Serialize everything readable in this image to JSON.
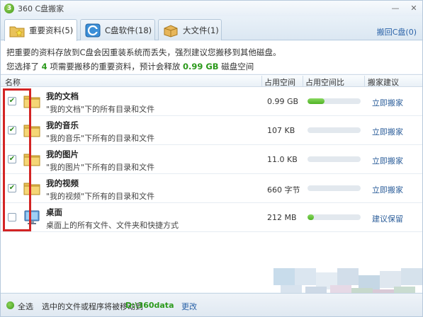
{
  "window": {
    "title": "360 C盘搬家",
    "logo_text": "3"
  },
  "tabs": [
    {
      "label": "重要资料(5)"
    },
    {
      "label": "C盘软件(18)"
    },
    {
      "label": "大文件(1)"
    }
  ],
  "header_link": "搬回C盘(0)",
  "info": {
    "line1": "把重要的资料存放到C盘会因重装系统而丢失，强烈建议您搬移到其他磁盘。",
    "line2_a": "您选择了 ",
    "line2_count": "4",
    "line2_b": " 项需要搬移的重要资料，预计会释放 ",
    "line2_size": "0.99 GB",
    "line2_c": " 磁盘空间"
  },
  "columns": {
    "name": "名称",
    "size": "占用空间",
    "ratio": "占用空间比",
    "advice": "搬家建议"
  },
  "rows": [
    {
      "name": "我的文档",
      "desc": "\"我的文档\"下的所有目录和文件",
      "size": "0.99 GB",
      "ratio": 0.32,
      "action": "立即搬家",
      "checked": true
    },
    {
      "name": "我的音乐",
      "desc": "\"我的音乐\"下所有的目录和文件",
      "size": "107 KB",
      "ratio": 0.0,
      "action": "立即搬家",
      "checked": true
    },
    {
      "name": "我的图片",
      "desc": "\"我的图片\"下所有的目录和文件",
      "size": "11.0 KB",
      "ratio": 0.0,
      "action": "立即搬家",
      "checked": true
    },
    {
      "name": "我的视频",
      "desc": "\"我的视频\"下所有的目录和文件",
      "size": "660 字节",
      "ratio": 0.0,
      "action": "立即搬家",
      "checked": true
    },
    {
      "name": "桌面",
      "desc": "桌面上的所有文件、文件夹和快捷方式",
      "size": "212 MB",
      "ratio": 0.06,
      "action": "建议保留",
      "checked": false
    }
  ],
  "footer": {
    "select_all": "全选",
    "move_text": "选中的文件或程序将被移动到",
    "move_path": "D:\\360data",
    "change": "更改"
  },
  "check_glyph": "✔",
  "colors": {
    "accent_green": "#2c9a1c",
    "link_blue": "#2a62a8",
    "highlight_red": "#d32424"
  },
  "icons": [
    "folder-icon",
    "desktop-icon",
    "star-folder-icon",
    "c-drive-icon",
    "box-icon"
  ]
}
